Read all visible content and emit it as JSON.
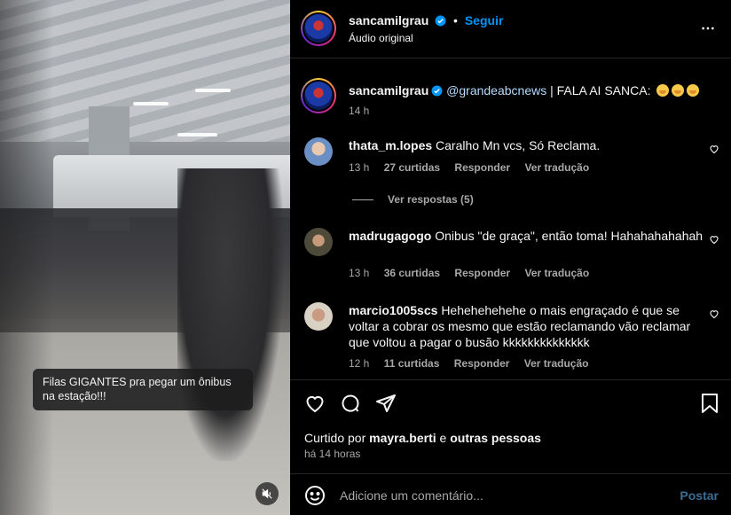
{
  "video": {
    "caption": "Filas GIGANTES pra pegar um ônibus na estação!!!",
    "mute_icon": "speaker-muted-icon"
  },
  "header": {
    "username": "sancamilgrau",
    "follow_label": "Seguir",
    "audio_label": "Áudio original",
    "more_icon": "more-horizontal-icon"
  },
  "post": {
    "username": "sancamilgrau",
    "mention": "@grandeabcnews",
    "text": " | FALA AI SANCA:",
    "time": "14 h"
  },
  "comments": [
    {
      "username": "thata_m.lopes",
      "text": "Caralho Mn vcs, Só Reclama.",
      "time": "13 h",
      "likes": "27 curtidas",
      "reply": "Responder",
      "translate": "Ver tradução",
      "view_replies": "Ver respostas (5)",
      "avatar_color": "#6a8fc5"
    },
    {
      "username": "madrugagogo",
      "text": "Onibus \"de graça\", então toma! Hahahahahahah",
      "time": "13 h",
      "likes": "36 curtidas",
      "reply": "Responder",
      "translate": "Ver tradução",
      "avatar_color": "#4d4a3a"
    },
    {
      "username": "marcio1005scs",
      "text": "Hehehehehehe o mais engraçado é que se voltar a cobrar os mesmo que estão reclamando vão reclamar que voltou a pagar o busão kkkkkkkkkkkkkk",
      "time": "12 h",
      "likes": "11 curtidas",
      "reply": "Responder",
      "translate": "Ver tradução",
      "avatar_color": "#d9d2c4"
    }
  ],
  "actions": {
    "liked_prefix": "Curtido por",
    "liked_user": "mayra.berti",
    "liked_mid": "e",
    "liked_others": "outras pessoas",
    "time": "há 14 horas"
  },
  "add_comment": {
    "placeholder": "Adicione um comentário...",
    "post_label": "Postar"
  },
  "colors": {
    "accent": "#0095f6",
    "muted_text": "#a8a8a8",
    "divider": "#262626"
  }
}
